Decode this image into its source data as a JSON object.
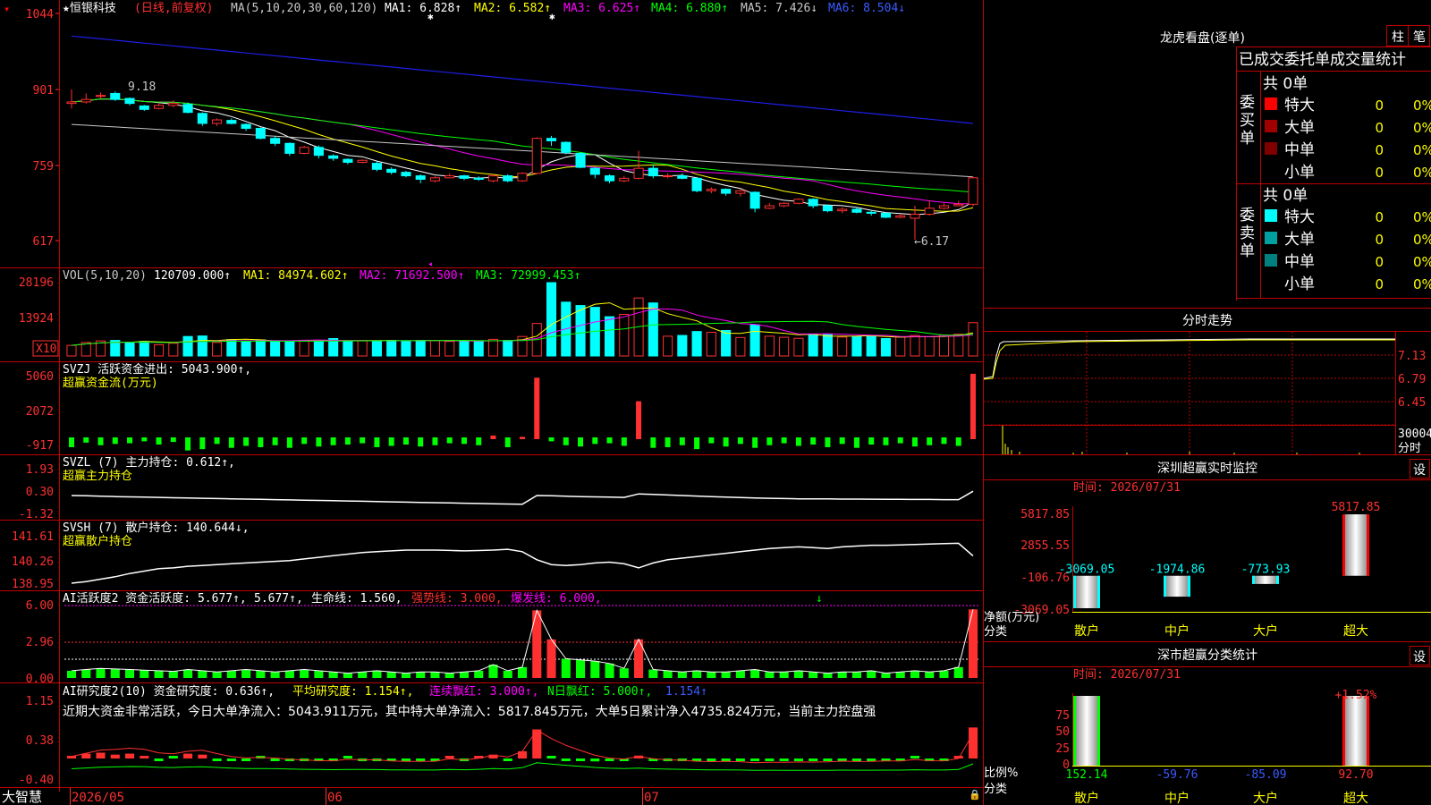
{
  "colors": {
    "up": "#ff3030",
    "down": "#00ffff",
    "bg": "#000000",
    "grid": "#c00000",
    "ma1": "#ffffff",
    "ma2": "#ffff00",
    "ma3": "#ff00ff",
    "ma4": "#00ff00",
    "ma5": "#c8c8c8",
    "ma6": "#1e1ee8",
    "white": "#ffffff",
    "yellow": "#ffff00",
    "magenta": "#ff00ff",
    "green": "#00ff00",
    "blue": "#3a5bff",
    "cyan": "#00ffff"
  },
  "header": {
    "stock": "★恒银科技",
    "mode": "(日线,前复权)",
    "ma_params": "MA(5,10,20,30,60,120)",
    "ma1": "MA1: 6.828↑",
    "ma2": "MA2: 6.582↑",
    "ma3": "MA3: 6.625↑",
    "ma4": "MA4: 6.880↑",
    "ma5": "MA5: 7.426↓",
    "ma6": "MA6: 8.504↓"
  },
  "price_panel": {
    "ticks": [
      "1044",
      "901",
      "759",
      "617"
    ],
    "high_label": "9.18",
    "low_label": "←6.17"
  },
  "vol_panel": {
    "header": "VOL(5,10,20)",
    "value": "120709.000↑",
    "ma1": "MA1: 84974.602↑",
    "ma2": "MA2: 71692.500↑",
    "ma3": "MA3: 72999.453↑",
    "ticks": [
      "28196",
      "13924"
    ],
    "unit": "X10"
  },
  "svzj_panel": {
    "header": "SVZJ  活跃资金进出: 5043.900↑,",
    "subtitle": "超赢资金流(万元)",
    "ticks": [
      "5060",
      "2072",
      "-917"
    ]
  },
  "svzl_panel": {
    "header": "SVZL (7) 主力持仓: 0.612↑,",
    "subtitle": "超赢主力持仓",
    "ticks": [
      "1.93",
      "0.30",
      "-1.32"
    ]
  },
  "svsh_panel": {
    "header": "SVSH (7) 散户持仓: 140.644↓,",
    "subtitle": "超赢散户持仓",
    "ticks": [
      "141.61",
      "140.26",
      "138.95"
    ]
  },
  "ai_active_panel": {
    "header1": "AI活跃度2 资金活跃度: 5.677↑,",
    "header2": "5.677↑,",
    "header3": "生命线: 1.560,",
    "header4": "强势线: 3.000,",
    "header5": "爆发线: 6.000,",
    "ticks": [
      "6.00",
      "2.96",
      "0.00"
    ]
  },
  "ai_research_panel": {
    "header1": "AI研究度2(10) 资金研究度: 0.636↑,",
    "header2": "平均研究度: 1.154↑,",
    "header3": "连续飘红: 3.000↑,",
    "header4": "N日飘红: 5.000↑,",
    "header5": "1.154↑",
    "note": "近期大资金非常活跃，今日大单净流入：5043.911万元，其中特大单净流入：5817.845万元，大单5日累计净入4735.824万元，当前主力控盘强",
    "ticks": [
      "1.15",
      "0.38",
      "-0.40"
    ]
  },
  "footer": {
    "brand": "大智慧",
    "dates": [
      "2026/05",
      "06",
      "07"
    ]
  },
  "right": {
    "lhb_title": "龙虎看盘(逐单)",
    "tab1": "柱",
    "tab2": "笔",
    "stats_title": "已成交委托单成交量统计",
    "buy_group": {
      "label": "委买单",
      "total": "共 0单",
      "rows": [
        {
          "name": "特大",
          "count": "0",
          "pct": "0%",
          "color": "#ff0000"
        },
        {
          "name": "大单",
          "count": "0",
          "pct": "0%",
          "color": "#a00000"
        },
        {
          "name": "中单",
          "count": "0",
          "pct": "0%",
          "color": "#800000"
        },
        {
          "name": "小单",
          "count": "0",
          "pct": "0%",
          "color": ""
        }
      ]
    },
    "sell_group": {
      "label": "委卖单",
      "total": "共 0单",
      "rows": [
        {
          "name": "特大",
          "count": "0",
          "pct": "0%",
          "color": "#00ffff"
        },
        {
          "name": "大单",
          "count": "0",
          "pct": "0%",
          "color": "#00a0a0"
        },
        {
          "name": "中单",
          "count": "0",
          "pct": "0%",
          "color": "#008080"
        },
        {
          "name": "小单",
          "count": "0",
          "pct": "0%",
          "color": ""
        }
      ]
    },
    "intraday_title": "分时走势",
    "intraday_ticks": [
      "7.13",
      "6.79",
      "6.45"
    ],
    "intraday_vol": "30004",
    "intraday_vol_label": "分时",
    "monitor": {
      "title": "深圳超赢实时监控",
      "button": "设",
      "time": "时间: 2026/07/31",
      "ticks": [
        "5817.85",
        "2855.55",
        "-106.76",
        "-3069.05"
      ],
      "ylabel1": "净额(万元)",
      "ylabel2": "分类",
      "bars": [
        {
          "cat": "散户",
          "value": -3069.05,
          "label": "-3069.05"
        },
        {
          "cat": "中户",
          "value": -1974.86,
          "label": "-1974.86"
        },
        {
          "cat": "大户",
          "value": -773.93,
          "label": "-773.93"
        },
        {
          "cat": "超大",
          "value": 5817.85,
          "label": "5817.85"
        }
      ]
    },
    "class_stats": {
      "title": "深市超赢分类统计",
      "button": "设",
      "time": "时间: 2026/07/31",
      "ticks": [
        "75",
        "50",
        "25",
        "0"
      ],
      "ylabel1": "比例%",
      "ylabel2": "分类",
      "top_label": "+1.52%",
      "bars": [
        {
          "cat": "散户",
          "value": 152.14,
          "label": "152.14"
        },
        {
          "cat": "中户",
          "value": -59.76,
          "label": "-59.76"
        },
        {
          "cat": "大户",
          "value": -85.09,
          "label": "-85.09"
        },
        {
          "cat": "超大",
          "value": 92.7,
          "label": "92.70"
        }
      ]
    }
  },
  "chart_data": {
    "type": "candlestick",
    "note": "prices in yuan, chronological",
    "candles": [
      [
        8.9,
        8.93,
        9.18,
        8.8
      ],
      [
        8.93,
        8.98,
        9.1,
        8.9
      ],
      [
        9.05,
        9.06,
        9.12,
        9.0
      ],
      [
        9.1,
        8.98,
        9.14,
        8.95
      ],
      [
        9.0,
        8.9,
        9.02,
        8.86
      ],
      [
        8.85,
        8.78,
        8.87,
        8.75
      ],
      [
        8.8,
        8.86,
        8.9,
        8.78
      ],
      [
        8.86,
        8.9,
        8.96,
        8.82
      ],
      [
        8.88,
        8.72,
        8.92,
        8.7
      ],
      [
        8.7,
        8.5,
        8.72,
        8.45
      ],
      [
        8.5,
        8.57,
        8.6,
        8.45
      ],
      [
        8.56,
        8.5,
        8.6,
        8.48
      ],
      [
        8.48,
        8.4,
        8.5,
        8.35
      ],
      [
        8.4,
        8.2,
        8.42,
        8.18
      ],
      [
        8.2,
        8.1,
        8.24,
        8.05
      ],
      [
        8.1,
        7.9,
        8.12,
        7.85
      ],
      [
        7.9,
        8.02,
        8.05,
        7.88
      ],
      [
        8.02,
        7.86,
        8.06,
        7.8
      ],
      [
        7.85,
        7.8,
        7.88,
        7.75
      ],
      [
        7.78,
        7.72,
        7.8,
        7.68
      ],
      [
        7.72,
        7.76,
        7.78,
        7.7
      ],
      [
        7.7,
        7.58,
        7.74,
        7.54
      ],
      [
        7.58,
        7.52,
        7.62,
        7.48
      ],
      [
        7.52,
        7.45,
        7.55,
        7.42
      ],
      [
        7.45,
        7.38,
        7.48,
        7.3
      ],
      [
        7.35,
        7.41,
        7.44,
        7.32
      ],
      [
        7.41,
        7.45,
        7.5,
        7.4
      ],
      [
        7.45,
        7.4,
        7.47,
        7.36
      ],
      [
        7.4,
        7.38,
        7.44,
        7.35
      ],
      [
        7.35,
        7.45,
        7.48,
        7.32
      ],
      [
        7.45,
        7.35,
        7.48,
        7.32
      ],
      [
        7.35,
        7.5,
        7.52,
        7.33
      ],
      [
        7.5,
        8.2,
        8.22,
        7.48
      ],
      [
        8.2,
        8.15,
        8.25,
        8.05
      ],
      [
        8.12,
        7.92,
        8.14,
        7.88
      ],
      [
        7.9,
        7.62,
        7.92,
        7.6
      ],
      [
        7.6,
        7.48,
        7.62,
        7.4
      ],
      [
        7.45,
        7.35,
        7.48,
        7.3
      ],
      [
        7.35,
        7.4,
        7.45,
        7.32
      ],
      [
        7.4,
        7.6,
        7.95,
        7.38
      ],
      [
        7.6,
        7.45,
        7.68,
        7.4
      ],
      [
        7.45,
        7.45,
        7.5,
        7.4
      ],
      [
        7.45,
        7.4,
        7.5,
        7.38
      ],
      [
        7.4,
        7.15,
        7.42,
        7.12
      ],
      [
        7.15,
        7.18,
        7.22,
        7.1
      ],
      [
        7.18,
        7.1,
        7.2,
        7.05
      ],
      [
        7.1,
        7.15,
        7.18,
        7.04
      ],
      [
        7.12,
        6.8,
        7.14,
        6.72
      ],
      [
        6.8,
        6.85,
        6.9,
        6.78
      ],
      [
        6.85,
        6.9,
        6.92,
        6.82
      ],
      [
        6.9,
        6.98,
        7.0,
        6.88
      ],
      [
        6.98,
        6.85,
        7.0,
        6.8
      ],
      [
        6.85,
        6.75,
        6.88,
        6.72
      ],
      [
        6.75,
        6.78,
        6.82,
        6.7
      ],
      [
        6.78,
        6.72,
        6.82,
        6.7
      ],
      [
        6.72,
        6.7,
        6.76,
        6.65
      ],
      [
        6.7,
        6.62,
        6.72,
        6.6
      ],
      [
        6.62,
        6.65,
        6.68,
        6.6
      ],
      [
        6.6,
        6.68,
        6.85,
        6.17
      ],
      [
        6.68,
        6.8,
        6.96,
        6.65
      ],
      [
        6.8,
        6.85,
        6.9,
        6.78
      ],
      [
        6.85,
        6.88,
        6.95,
        6.84
      ],
      [
        6.88,
        7.41,
        7.43,
        6.84
      ]
    ],
    "volume": [
      4100,
      5200,
      5800,
      6000,
      5300,
      5600,
      4300,
      4900,
      7500,
      7700,
      5200,
      6300,
      5700,
      6200,
      5600,
      5500,
      6000,
      5700,
      6700,
      5600,
      5800,
      5800,
      6000,
      5900,
      6000,
      5900,
      5600,
      5600,
      5700,
      6400,
      6000,
      7500,
      12500,
      28200,
      20700,
      19400,
      18700,
      15100,
      16000,
      22300,
      20400,
      7600,
      7900,
      9400,
      9100,
      9800,
      7100,
      12000,
      7600,
      7200,
      6800,
      8300,
      8400,
      7300,
      7400,
      7600,
      6700,
      7300,
      7900,
      7400,
      8100,
      8400,
      12800
    ],
    "svzj": [
      -150,
      -80,
      -120,
      -100,
      -90,
      -60,
      -110,
      -70,
      -200,
      -180,
      -100,
      -160,
      -130,
      -150,
      -120,
      -160,
      -100,
      -140,
      -120,
      -110,
      -90,
      -150,
      -130,
      -110,
      -140,
      -120,
      -90,
      -100,
      -120,
      280,
      -150,
      180,
      4700,
      -60,
      -120,
      -140,
      -100,
      -90,
      -130,
      2900,
      -160,
      -150,
      -120,
      -180,
      -90,
      -140,
      -100,
      -160,
      -120,
      -90,
      -130,
      -110,
      -150,
      -100,
      -160,
      -110,
      -120,
      -90,
      -140,
      -120,
      -100,
      -130,
      5000
    ],
    "svzl": [
      0.3,
      0.28,
      0.25,
      0.22,
      0.2,
      0.18,
      0.16,
      0.14,
      0.12,
      0.1,
      0.08,
      0.06,
      0.04,
      0.02,
      0.0,
      -0.02,
      -0.04,
      -0.06,
      -0.08,
      -0.1,
      -0.12,
      -0.14,
      -0.16,
      -0.18,
      -0.2,
      -0.22,
      -0.24,
      -0.26,
      -0.28,
      -0.3,
      -0.32,
      -0.34,
      0.3,
      0.28,
      0.25,
      0.22,
      0.2,
      0.18,
      0.16,
      0.42,
      0.38,
      0.34,
      0.3,
      0.26,
      0.22,
      0.18,
      0.15,
      0.12,
      0.1,
      0.08,
      0.06,
      0.05,
      0.05,
      0.04,
      0.04,
      0.03,
      0.02,
      0.02,
      0.01,
      0.01,
      0.0,
      0.0,
      0.61
    ],
    "svsh": [
      138.95,
      139.05,
      139.2,
      139.35,
      139.55,
      139.7,
      139.85,
      139.9,
      140.0,
      140.05,
      140.1,
      140.15,
      140.2,
      140.25,
      140.3,
      140.35,
      140.45,
      140.55,
      140.65,
      140.75,
      140.85,
      140.9,
      140.95,
      141.0,
      141.0,
      141.0,
      140.98,
      140.95,
      140.97,
      141.0,
      141.05,
      140.9,
      140.4,
      140.1,
      140.05,
      140.1,
      140.2,
      140.25,
      140.15,
      139.9,
      140.2,
      140.4,
      140.5,
      140.6,
      140.7,
      140.8,
      140.9,
      141.0,
      141.1,
      141.15,
      141.2,
      141.15,
      141.1,
      141.2,
      141.25,
      141.3,
      141.3,
      141.32,
      141.35,
      141.38,
      141.4,
      141.42,
      140.64
    ],
    "ai_active": [
      0.6,
      0.7,
      0.8,
      0.75,
      0.7,
      0.65,
      0.6,
      0.55,
      0.7,
      0.6,
      0.5,
      0.6,
      0.7,
      0.6,
      0.5,
      0.6,
      0.7,
      0.6,
      0.5,
      0.4,
      0.5,
      0.6,
      0.5,
      0.4,
      0.5,
      0.5,
      0.4,
      0.5,
      0.6,
      1.1,
      0.6,
      0.9,
      5.6,
      3.2,
      1.6,
      1.5,
      1.4,
      1.2,
      0.8,
      3.2,
      0.7,
      0.6,
      0.5,
      0.6,
      0.5,
      0.5,
      0.6,
      0.7,
      0.5,
      0.5,
      0.6,
      0.5,
      0.4,
      0.5,
      0.5,
      0.6,
      0.4,
      0.5,
      0.6,
      0.5,
      0.6,
      0.9,
      5.68
    ],
    "ai_research": [
      0.05,
      0.1,
      0.12,
      0.08,
      0.1,
      0.05,
      -0.02,
      0.02,
      0.1,
      0.08,
      -0.02,
      -0.04,
      -0.02,
      0.02,
      -0.01,
      -0.03,
      -0.02,
      -0.03,
      -0.02,
      0.02,
      -0.02,
      -0.01,
      -0.04,
      -0.03,
      -0.02,
      -0.02,
      0.04,
      -0.03,
      0.03,
      0.08,
      -0.02,
      0.15,
      0.6,
      0.0,
      -0.02,
      -0.03,
      -0.06,
      -0.05,
      -0.02,
      0.06,
      -0.04,
      -0.03,
      -0.02,
      -0.04,
      -0.03,
      -0.02,
      -0.03,
      -0.05,
      -0.02,
      -0.03,
      -0.02,
      -0.03,
      -0.02,
      -0.01,
      -0.03,
      -0.02,
      -0.01,
      -0.02,
      0.02,
      -0.04,
      -0.02,
      0.04,
      0.64
    ]
  }
}
